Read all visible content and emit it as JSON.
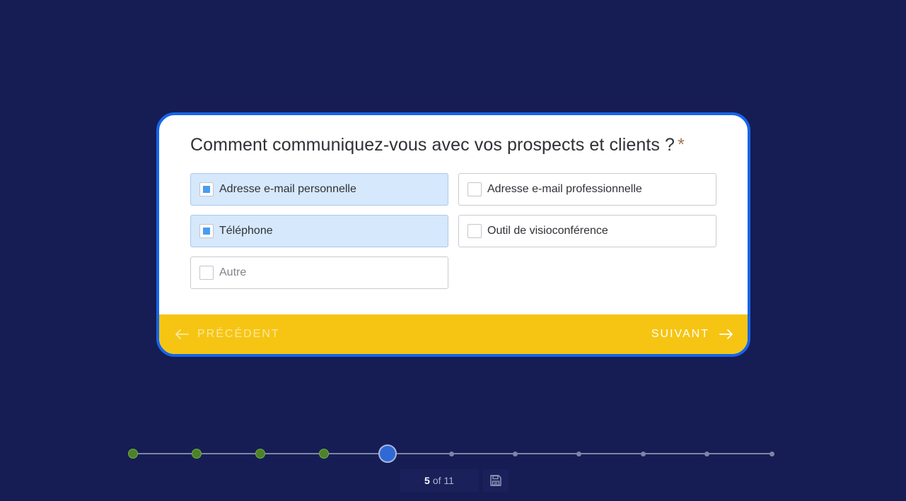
{
  "question": {
    "text": "Comment communiquez-vous avec vos prospects et clients ?",
    "required_mark": "*"
  },
  "options": [
    {
      "label": "Adresse e-mail personnelle",
      "checked": true
    },
    {
      "label": "Adresse e-mail professionnelle",
      "checked": false
    },
    {
      "label": "Téléphone",
      "checked": true
    },
    {
      "label": "Outil de visioconférence",
      "checked": false
    },
    {
      "label": "Autre",
      "checked": false
    }
  ],
  "navigation": {
    "prev_label": "PRÉCÉDENT",
    "next_label": "SUIVANT"
  },
  "progress": {
    "current": "5",
    "of_text": "of 11",
    "total_steps": 11,
    "current_step": 5
  },
  "colors": {
    "background": "#161d54",
    "card_border": "#1565e8",
    "footer": "#f6c513",
    "selected_option": "#d6e8fb",
    "done_dot": "#4d8229",
    "current_dot": "#2e69d6"
  },
  "icons": {
    "prev": "arrow-left-icon",
    "next": "arrow-right-icon",
    "save": "floppy-disk-icon"
  }
}
